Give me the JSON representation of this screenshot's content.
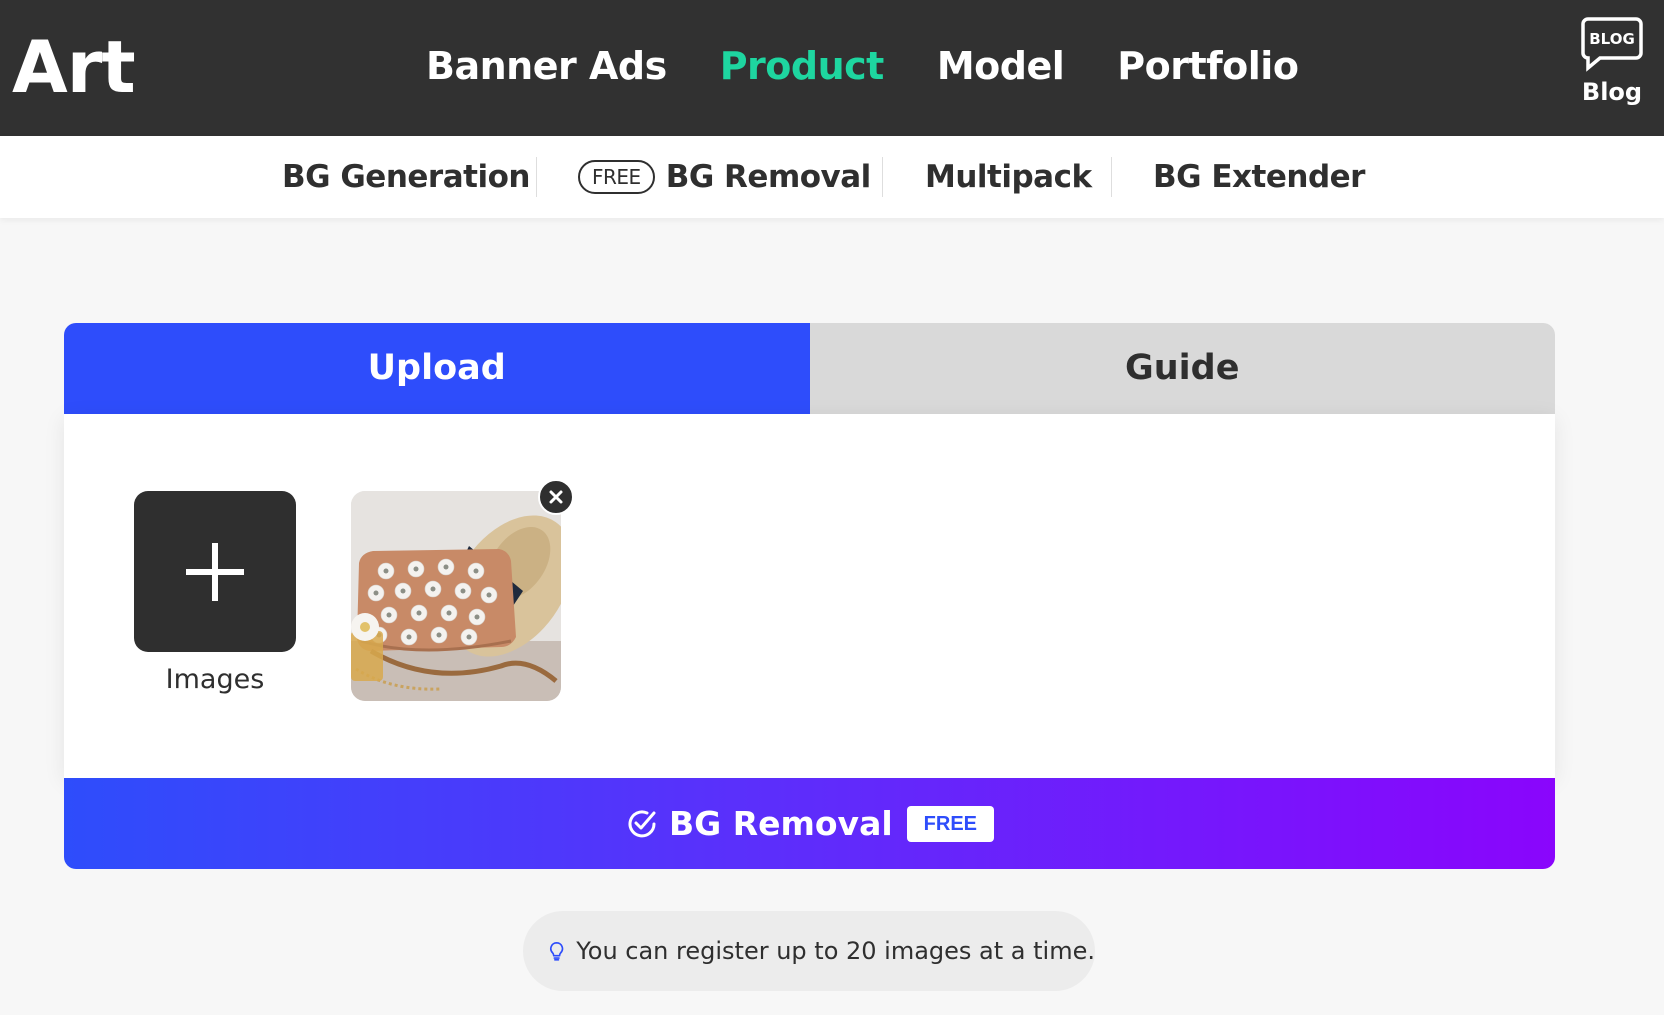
{
  "header": {
    "logo": "Art",
    "nav": [
      {
        "label": "Banner Ads",
        "active": false
      },
      {
        "label": "Product",
        "active": true
      },
      {
        "label": "Model",
        "active": false
      },
      {
        "label": "Portfolio",
        "active": false
      }
    ],
    "blog": {
      "icon_text": "BLOG",
      "label": "Blog",
      "icon": "speech-bubble-icon"
    }
  },
  "subnav": {
    "items": [
      {
        "label": "BG Generation"
      },
      {
        "label": "BG Removal",
        "badge": "FREE",
        "active": true
      },
      {
        "label": "Multipack"
      },
      {
        "label": "BG Extender"
      }
    ]
  },
  "tabs": {
    "upload": "Upload",
    "guide": "Guide",
    "active": "upload"
  },
  "uploader": {
    "add_label": "Images",
    "add_icon": "plus-icon",
    "uploaded_count": 1,
    "remove_icon": "close-icon",
    "thumbnail_icon": "product-photo-handbag"
  },
  "cta": {
    "label": "BG Removal",
    "badge": "FREE",
    "icon": "check-circle-icon"
  },
  "tip": {
    "icon": "lightbulb-icon",
    "text": "You can register up to 20 images at a time."
  },
  "colors": {
    "topbar_bg": "#313131",
    "active_nav": "#1ed6a0",
    "primary_blue": "#2e4dfb",
    "gradient_end": "#8a05fc"
  }
}
